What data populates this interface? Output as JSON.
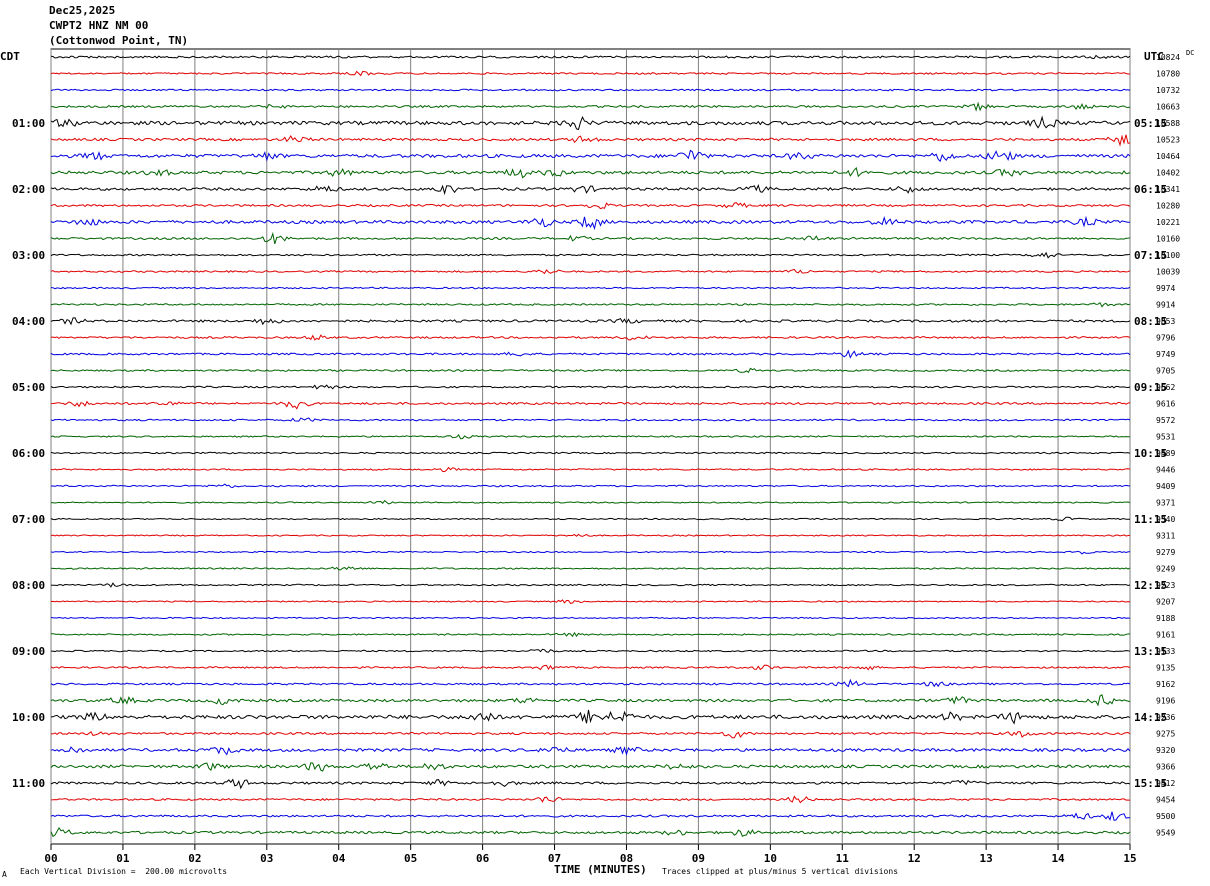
{
  "header": {
    "date": "Dec25,2025",
    "station": "CWPT2 HNZ NM 00",
    "location": "(Cottonwod Point, TN)"
  },
  "left_tz": "CDT",
  "right_tz": "UTC",
  "dc_label": "DC",
  "footer": {
    "mark": "A",
    "scale": "Each Vertical Division =  200.00 microvolts",
    "xtitle": "TIME (MINUTES)",
    "clip": "Traces clipped at plus/minus 5 vertical divisions"
  },
  "colors": {
    "trace_cycle": [
      "#000000",
      "#e00000",
      "#0000e0",
      "#006400"
    ],
    "grid": "#808080"
  },
  "chart_data": {
    "type": "line",
    "xlabel": "TIME (MINUTES)",
    "xlim": [
      0,
      15
    ],
    "x_ticks": [
      "00",
      "01",
      "02",
      "03",
      "04",
      "05",
      "06",
      "07",
      "08",
      "09",
      "10",
      "11",
      "12",
      "13",
      "14",
      "15"
    ],
    "left_hour_labels": [
      "01:00",
      "02:00",
      "03:00",
      "04:00",
      "05:00",
      "06:00",
      "07:00",
      "08:00",
      "09:00",
      "10:00",
      "11:00"
    ],
    "right_hour_labels": [
      "05:15",
      "06:15",
      "07:15",
      "08:15",
      "09:15",
      "10:15",
      "11:15",
      "12:15",
      "13:15",
      "14:15",
      "15:15"
    ],
    "traces": [
      {
        "dc": "10824",
        "amp": 1.0,
        "bursts": [
          [
            14.6,
            1
          ]
        ]
      },
      {
        "dc": "10780",
        "amp": 0.8,
        "bursts": [
          [
            4.3,
            1
          ]
        ]
      },
      {
        "dc": "10732",
        "amp": 0.8,
        "bursts": []
      },
      {
        "dc": "10663",
        "amp": 1.0,
        "bursts": [
          [
            3.1,
            1
          ],
          [
            12.9,
            2
          ],
          [
            14.3,
            1.5
          ]
        ]
      },
      {
        "dc": "10588",
        "amp": 1.8,
        "bursts": [
          [
            0.2,
            2
          ],
          [
            7.3,
            4
          ],
          [
            13.8,
            3
          ]
        ]
      },
      {
        "dc": "10523",
        "amp": 1.2,
        "bursts": [
          [
            3.4,
            2
          ],
          [
            7.4,
            2
          ],
          [
            14.9,
            4
          ]
        ]
      },
      {
        "dc": "10464",
        "amp": 1.6,
        "bursts": [
          [
            0.6,
            2
          ],
          [
            3.0,
            2
          ],
          [
            8.9,
            4
          ],
          [
            10.4,
            2
          ],
          [
            12.4,
            3
          ],
          [
            13.2,
            4
          ]
        ]
      },
      {
        "dc": "10402",
        "amp": 1.5,
        "bursts": [
          [
            1.5,
            1.5
          ],
          [
            4.0,
            2
          ],
          [
            6.5,
            3
          ],
          [
            7.0,
            2
          ],
          [
            11.2,
            2
          ],
          [
            13.3,
            2
          ]
        ]
      },
      {
        "dc": "10341",
        "amp": 1.3,
        "bursts": [
          [
            3.8,
            2
          ],
          [
            5.5,
            3
          ],
          [
            7.4,
            2
          ],
          [
            9.8,
            2
          ],
          [
            11.9,
            2
          ]
        ]
      },
      {
        "dc": "10280",
        "amp": 1.0,
        "bursts": [
          [
            7.6,
            2
          ],
          [
            9.5,
            1.5
          ]
        ]
      },
      {
        "dc": "10221",
        "amp": 1.5,
        "bursts": [
          [
            0.5,
            2
          ],
          [
            6.8,
            3
          ],
          [
            7.5,
            4
          ],
          [
            11.6,
            2
          ],
          [
            14.4,
            2
          ]
        ]
      },
      {
        "dc": "10160",
        "amp": 1.0,
        "bursts": [
          [
            3.1,
            3
          ],
          [
            7.3,
            1.5
          ],
          [
            10.6,
            1.5
          ]
        ]
      },
      {
        "dc": "10100",
        "amp": 0.8,
        "bursts": [
          [
            13.8,
            2
          ]
        ]
      },
      {
        "dc": "10039",
        "amp": 0.8,
        "bursts": [
          [
            6.9,
            1.5
          ],
          [
            10.4,
            1.2
          ]
        ]
      },
      {
        "dc": "9974",
        "amp": 0.7,
        "bursts": []
      },
      {
        "dc": "9914",
        "amp": 0.8,
        "bursts": [
          [
            14.6,
            1
          ]
        ]
      },
      {
        "dc": "9853",
        "amp": 1.1,
        "bursts": [
          [
            0.3,
            1.5
          ],
          [
            3.0,
            2
          ],
          [
            8.0,
            1.2
          ]
        ]
      },
      {
        "dc": "9796",
        "amp": 0.9,
        "bursts": [
          [
            3.7,
            1.3
          ],
          [
            8.1,
            1.5
          ]
        ]
      },
      {
        "dc": "9749",
        "amp": 0.9,
        "bursts": [
          [
            6.5,
            1.2
          ],
          [
            11.1,
            2
          ]
        ]
      },
      {
        "dc": "9705",
        "amp": 0.8,
        "bursts": [
          [
            9.7,
            1.2
          ]
        ]
      },
      {
        "dc": "9662",
        "amp": 0.8,
        "bursts": [
          [
            3.8,
            1.2
          ]
        ]
      },
      {
        "dc": "9616",
        "amp": 1.0,
        "bursts": [
          [
            0.4,
            1.5
          ],
          [
            1.6,
            1.5
          ],
          [
            3.4,
            3
          ]
        ]
      },
      {
        "dc": "9572",
        "amp": 0.8,
        "bursts": [
          [
            3.5,
            1.2
          ]
        ]
      },
      {
        "dc": "9531",
        "amp": 0.7,
        "bursts": [
          [
            5.7,
            1
          ]
        ]
      },
      {
        "dc": "9489",
        "amp": 0.7,
        "bursts": []
      },
      {
        "dc": "9446",
        "amp": 0.7,
        "bursts": [
          [
            5.5,
            1
          ]
        ]
      },
      {
        "dc": "9409",
        "amp": 0.7,
        "bursts": [
          [
            2.4,
            1.2
          ]
        ]
      },
      {
        "dc": "9371",
        "amp": 0.6,
        "bursts": [
          [
            4.6,
            1
          ]
        ]
      },
      {
        "dc": "9340",
        "amp": 0.6,
        "bursts": [
          [
            14.1,
            1
          ]
        ]
      },
      {
        "dc": "9311",
        "amp": 0.6,
        "bursts": [
          [
            7.3,
            1
          ]
        ]
      },
      {
        "dc": "9279",
        "amp": 0.6,
        "bursts": [
          [
            14.3,
            1
          ]
        ]
      },
      {
        "dc": "9249",
        "amp": 0.7,
        "bursts": [
          [
            4.1,
            1.5
          ]
        ]
      },
      {
        "dc": "9223",
        "amp": 0.7,
        "bursts": [
          [
            0.9,
            1.2
          ]
        ]
      },
      {
        "dc": "9207",
        "amp": 0.6,
        "bursts": [
          [
            7.2,
            1
          ]
        ]
      },
      {
        "dc": "9188",
        "amp": 0.6,
        "bursts": []
      },
      {
        "dc": "9161",
        "amp": 0.7,
        "bursts": [
          [
            7.2,
            1
          ]
        ]
      },
      {
        "dc": "9133",
        "amp": 0.7,
        "bursts": [
          [
            6.8,
            1.5
          ]
        ]
      },
      {
        "dc": "9135",
        "amp": 0.8,
        "bursts": [
          [
            6.9,
            1.5
          ],
          [
            9.9,
            1.5
          ],
          [
            11.3,
            1.5
          ]
        ]
      },
      {
        "dc": "9162",
        "amp": 0.9,
        "bursts": [
          [
            11.1,
            2
          ],
          [
            12.3,
            1.5
          ]
        ]
      },
      {
        "dc": "9196",
        "amp": 1.3,
        "bursts": [
          [
            1.0,
            2
          ],
          [
            2.4,
            2
          ],
          [
            6.6,
            1.5
          ],
          [
            12.6,
            2
          ],
          [
            14.6,
            3
          ]
        ]
      },
      {
        "dc": "9236",
        "amp": 1.8,
        "bursts": [
          [
            0.6,
            2
          ],
          [
            6.0,
            3
          ],
          [
            7.5,
            4
          ],
          [
            7.9,
            4
          ],
          [
            12.5,
            2
          ],
          [
            13.4,
            3
          ]
        ]
      },
      {
        "dc": "9275",
        "amp": 1.0,
        "bursts": [
          [
            0.7,
            1.2
          ],
          [
            9.5,
            2.5
          ],
          [
            13.5,
            2
          ]
        ]
      },
      {
        "dc": "9320",
        "amp": 1.4,
        "bursts": [
          [
            0.3,
            2
          ],
          [
            2.4,
            2.5
          ],
          [
            7.0,
            2
          ],
          [
            8.0,
            2
          ]
        ]
      },
      {
        "dc": "9366",
        "amp": 1.4,
        "bursts": [
          [
            2.2,
            2
          ],
          [
            3.7,
            3
          ],
          [
            4.5,
            2.5
          ],
          [
            5.3,
            2
          ],
          [
            8.7,
            1.5
          ]
        ]
      },
      {
        "dc": "9412",
        "amp": 1.1,
        "bursts": [
          [
            2.6,
            3
          ],
          [
            5.4,
            1.5
          ],
          [
            6.3,
            1.5
          ],
          [
            12.7,
            1.5
          ]
        ]
      },
      {
        "dc": "9454",
        "amp": 0.9,
        "bursts": [
          [
            6.9,
            2
          ],
          [
            10.4,
            2
          ]
        ]
      },
      {
        "dc": "9500",
        "amp": 1.0,
        "bursts": [
          [
            14.3,
            2
          ],
          [
            14.8,
            3
          ]
        ]
      },
      {
        "dc": "9549",
        "amp": 1.2,
        "bursts": [
          [
            0.1,
            2.5
          ],
          [
            8.7,
            1.5
          ],
          [
            9.6,
            2
          ]
        ]
      }
    ]
  }
}
